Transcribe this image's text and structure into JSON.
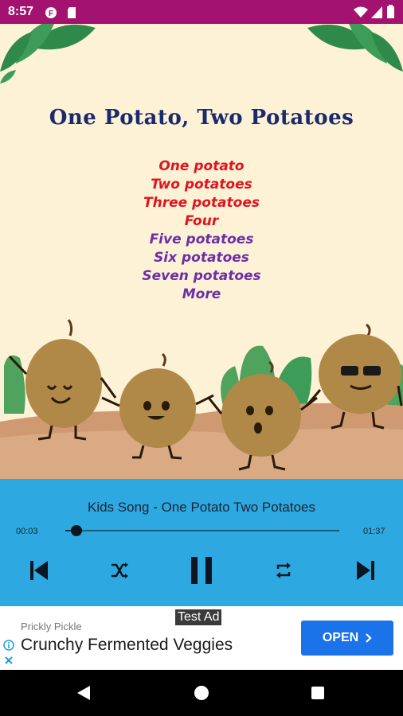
{
  "status_bar": {
    "time": "8:57"
  },
  "artwork": {
    "title": "One Potato, Two Potatoes",
    "lyrics": [
      "One potato",
      "Two potatoes",
      "Three potatoes",
      "Four",
      "Five potatoes",
      "Six potatoes",
      "Seven potatoes",
      "More"
    ]
  },
  "player": {
    "song_title": "Kids Song - One Potato Two Potatoes",
    "elapsed": "00:03",
    "duration": "01:37",
    "progress": 0.04
  },
  "ad": {
    "badge": "Test Ad",
    "advertiser": "Prickly Pickle",
    "headline": "Crunchy Fermented Veggies",
    "cta": "OPEN"
  },
  "colors": {
    "status_bar": "#a4126f",
    "player_bg": "#2ea8e0",
    "cta": "#1a73e8",
    "title": "#1a2a6c"
  },
  "icons": [
    "wifi-icon",
    "signal-icon",
    "battery-icon",
    "previous-icon",
    "shuffle-icon",
    "pause-icon",
    "repeat-icon",
    "next-icon",
    "info-icon",
    "close-icon",
    "back-icon",
    "home-icon",
    "recents-icon"
  ]
}
